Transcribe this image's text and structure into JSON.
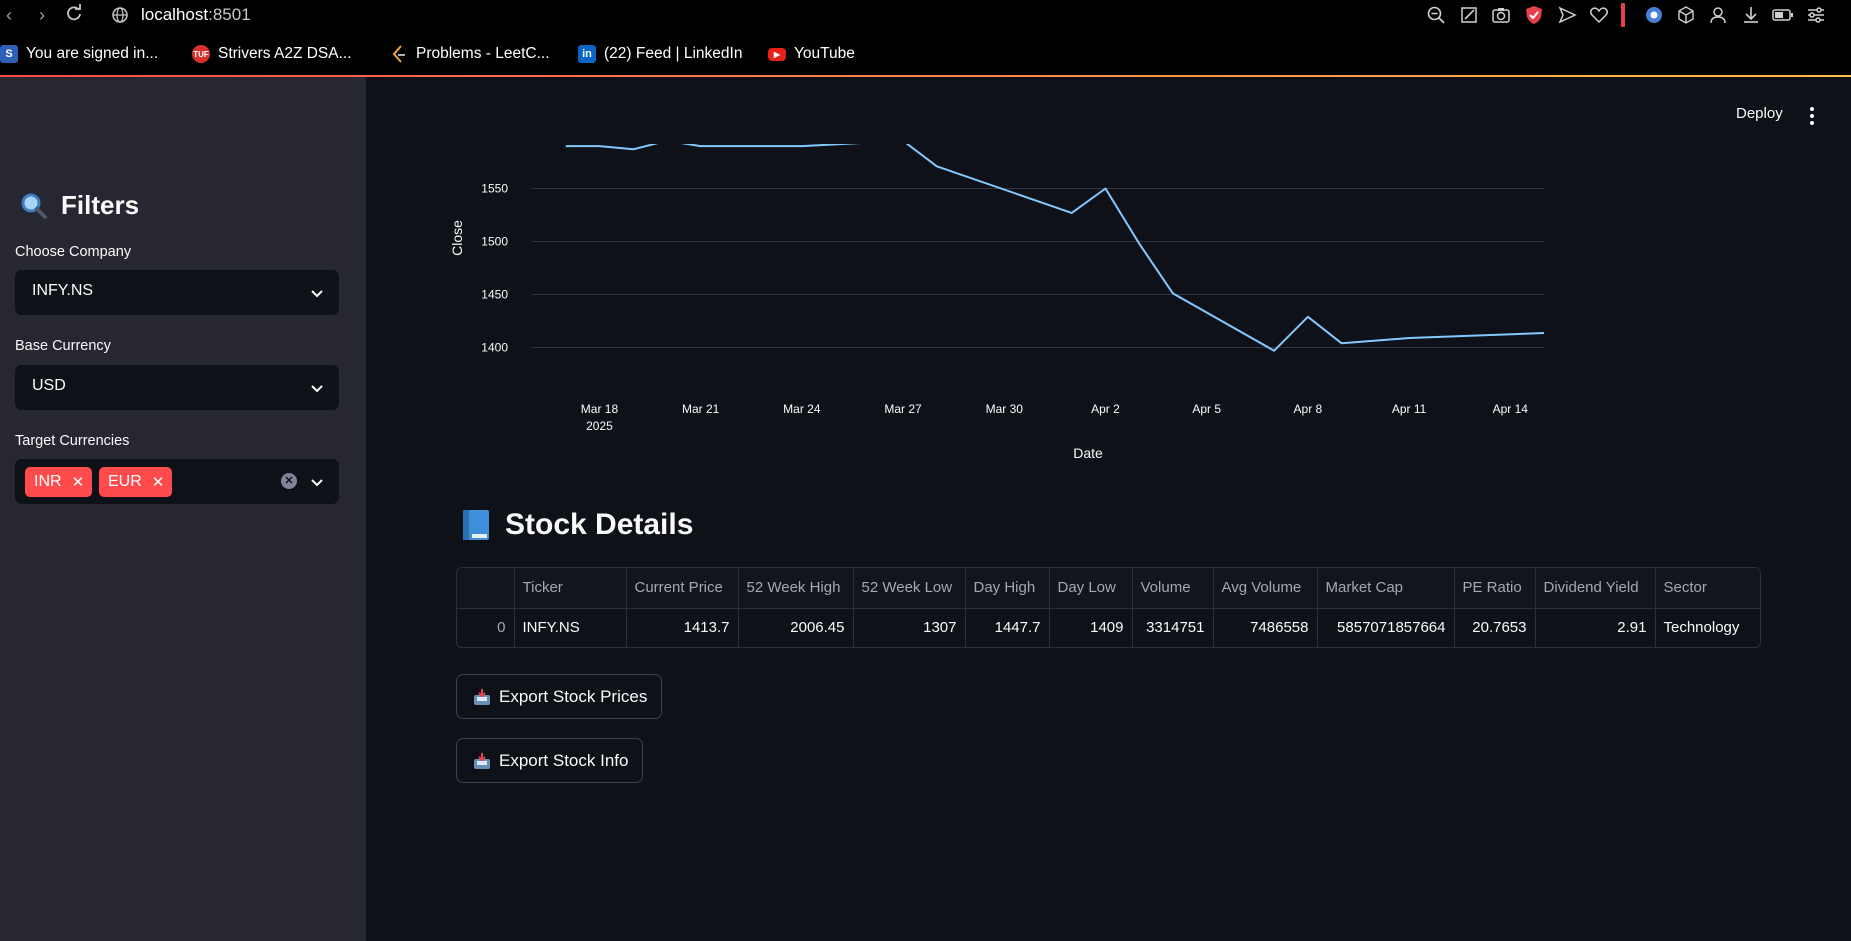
{
  "browser": {
    "url_host": "localhost",
    "url_port": ":8501",
    "bookmarks": [
      {
        "label": "You are signed in...",
        "icon": "s-badge-icon"
      },
      {
        "label": "Strivers A2Z DSA...",
        "icon": "tuf-logo-icon"
      },
      {
        "label": "Problems - LeetC...",
        "icon": "leetcode-icon"
      },
      {
        "label": "(22) Feed | LinkedIn",
        "icon": "linkedin-icon"
      },
      {
        "label": "YouTube",
        "icon": "youtube-icon"
      }
    ]
  },
  "sidebar": {
    "title": "Filters",
    "company": {
      "label": "Choose Company",
      "value": "INFY.NS"
    },
    "base_currency": {
      "label": "Base Currency",
      "value": "USD"
    },
    "target_currencies": {
      "label": "Target Currencies",
      "selected": [
        "INR",
        "EUR"
      ]
    }
  },
  "header": {
    "deploy_label": "Deploy"
  },
  "chart_data": {
    "type": "line",
    "xlabel": "Date",
    "ylabel": "Close",
    "x_ticks": [
      "Mar 18",
      "Mar 21",
      "Mar 24",
      "Mar 27",
      "Mar 30",
      "Apr 2",
      "Apr 5",
      "Apr 8",
      "Apr 11",
      "Apr 14"
    ],
    "x_tick_year": "2025",
    "y_ticks": [
      1400,
      1450,
      1500,
      1550
    ],
    "ylim": [
      1375,
      1592
    ],
    "xlim": [
      "2025-03-16",
      "2025-04-15"
    ],
    "grid": true,
    "series": [
      {
        "color": "#83c9ff",
        "x": [
          "2025-03-17",
          "2025-03-18",
          "2025-03-19",
          "2025-03-20",
          "2025-03-21",
          "2025-03-24",
          "2025-03-27",
          "2025-03-28",
          "2025-04-01",
          "2025-04-02",
          "2025-04-03",
          "2025-04-04",
          "2025-04-07",
          "2025-04-08",
          "2025-04-09",
          "2025-04-11",
          "2025-04-15"
        ],
        "y": [
          1590,
          1590,
          1587,
          1595,
          1590,
          1590,
          1595,
          1571,
          1527,
          1550,
          1498,
          1451,
          1397,
          1429,
          1404,
          1409,
          1413.7
        ]
      }
    ]
  },
  "stock_details": {
    "title": "Stock Details",
    "columns": [
      "",
      "Ticker",
      "Current Price",
      "52 Week High",
      "52 Week Low",
      "Day High",
      "Day Low",
      "Volume",
      "Avg Volume",
      "Market Cap",
      "PE Ratio",
      "Dividend Yield",
      "Sector"
    ],
    "rows": [
      [
        "0",
        "INFY.NS",
        "1413.7",
        "2006.45",
        "1307",
        "1447.7",
        "1409",
        "3314751",
        "7486558",
        "5857071857664",
        "20.7653",
        "2.91",
        "Technology"
      ]
    ]
  },
  "actions": {
    "export_prices": "Export Stock Prices",
    "export_info": "Export Stock Info"
  }
}
